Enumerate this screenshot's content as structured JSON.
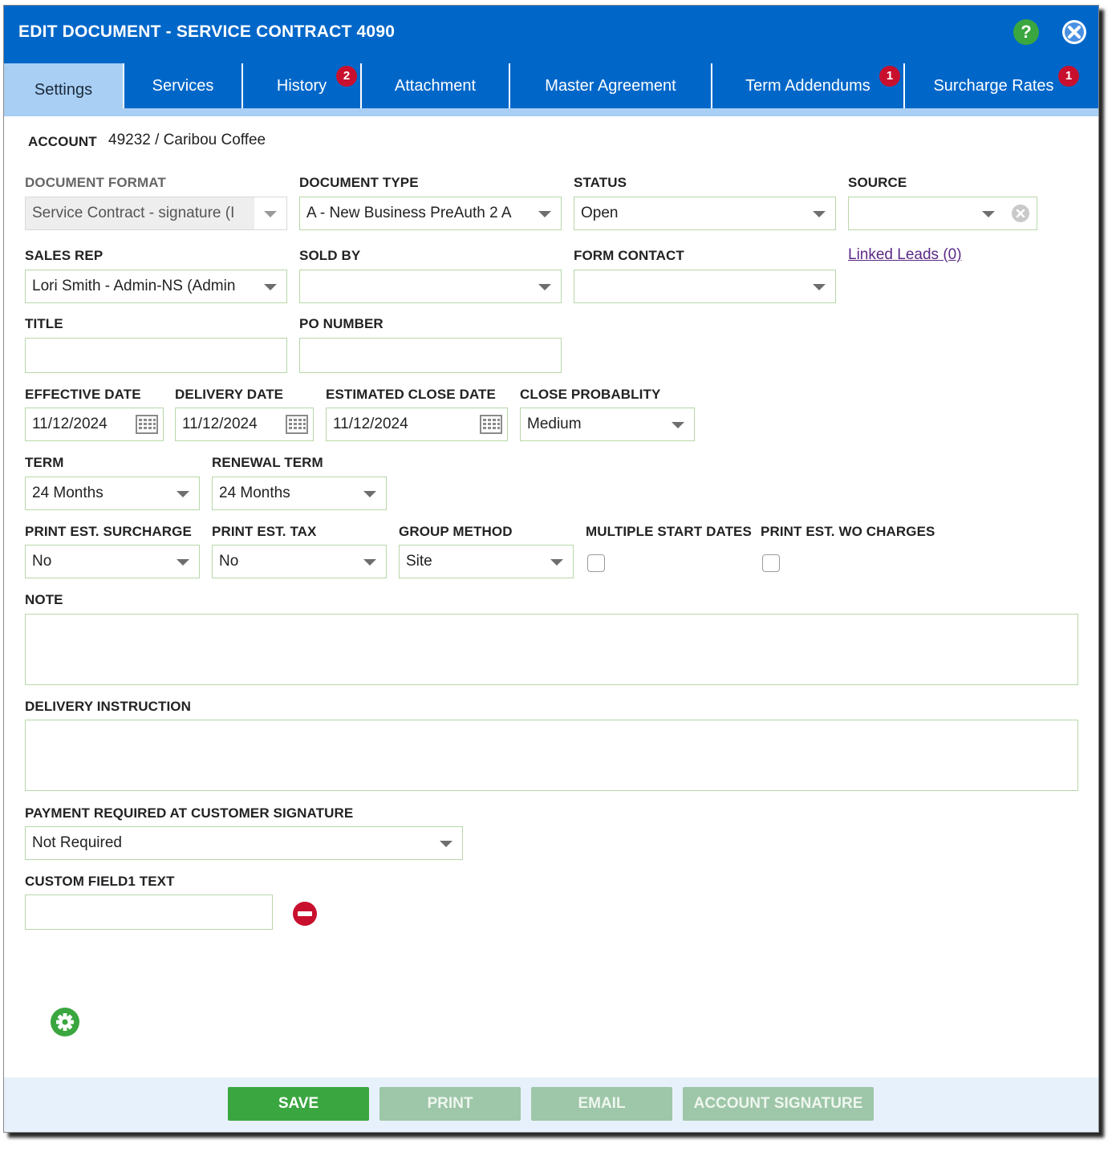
{
  "dialog": {
    "title": "EDIT DOCUMENT - SERVICE CONTRACT 4090",
    "help_label": "?"
  },
  "tabs": [
    {
      "label": "Settings",
      "active": true
    },
    {
      "label": "Services"
    },
    {
      "label": "History",
      "badge": "2"
    },
    {
      "label": "Attachment"
    },
    {
      "label": "Master Agreement"
    },
    {
      "label": "Term Addendums",
      "badge": "1"
    },
    {
      "label": "Surcharge Rates",
      "badge": "1"
    }
  ],
  "account": {
    "label": "ACCOUNT",
    "value": "49232 / Caribou Coffee"
  },
  "fields": {
    "document_format": {
      "label": "DOCUMENT FORMAT",
      "value": "Service Contract - signature (I"
    },
    "document_type": {
      "label": "DOCUMENT TYPE",
      "value": "A - New Business PreAuth 2 A"
    },
    "status": {
      "label": "STATUS",
      "value": "Open"
    },
    "source": {
      "label": "SOURCE",
      "value": ""
    },
    "sales_rep": {
      "label": "SALES REP",
      "value": "Lori Smith - Admin-NS (Admin"
    },
    "sold_by": {
      "label": "SOLD BY",
      "value": ""
    },
    "form_contact": {
      "label": "FORM CONTACT",
      "value": ""
    },
    "linked_leads": {
      "label": "Linked Leads (0)"
    },
    "title": {
      "label": "TITLE",
      "value": ""
    },
    "po_number": {
      "label": "PO NUMBER",
      "value": ""
    },
    "effective_date": {
      "label": "EFFECTIVE DATE",
      "value": "11/12/2024"
    },
    "delivery_date": {
      "label": "DELIVERY DATE",
      "value": "11/12/2024"
    },
    "estimated_close_date": {
      "label": "ESTIMATED CLOSE DATE",
      "value": "11/12/2024"
    },
    "close_probability": {
      "label": "CLOSE PROBABLITY",
      "value": "Medium"
    },
    "term": {
      "label": "TERM",
      "value": "24 Months"
    },
    "renewal_term": {
      "label": "RENEWAL TERM",
      "value": "24 Months"
    },
    "print_est_surcharge": {
      "label": "PRINT EST. SURCHARGE",
      "value": "No"
    },
    "print_est_tax": {
      "label": "PRINT EST. TAX",
      "value": "No"
    },
    "group_method": {
      "label": "GROUP METHOD",
      "value": "Site"
    },
    "multiple_start_dates": {
      "label": "MULTIPLE START DATES",
      "checked": false
    },
    "print_est_wo_charges": {
      "label": "PRINT EST. WO CHARGES",
      "checked": false
    },
    "note": {
      "label": "NOTE",
      "value": ""
    },
    "delivery_instruction": {
      "label": "DELIVERY INSTRUCTION",
      "value": ""
    },
    "payment_required": {
      "label": "PAYMENT REQUIRED AT CUSTOMER SIGNATURE",
      "value": "Not Required"
    },
    "custom_field1": {
      "label": "CUSTOM FIELD1 TEXT",
      "value": ""
    }
  },
  "footer": {
    "save": "SAVE",
    "print": "PRINT",
    "email": "EMAIL",
    "account_signature": "ACCOUNT SIGNATURE"
  },
  "colors": {
    "header_blue": "#0067c9",
    "active_tab": "#a9cff4",
    "badge_red": "#c8102e",
    "save_green": "#3aa63f",
    "disabled_green": "#9ec6a8",
    "field_border": "#b7d7a8",
    "link_purple": "#5b2a86"
  }
}
